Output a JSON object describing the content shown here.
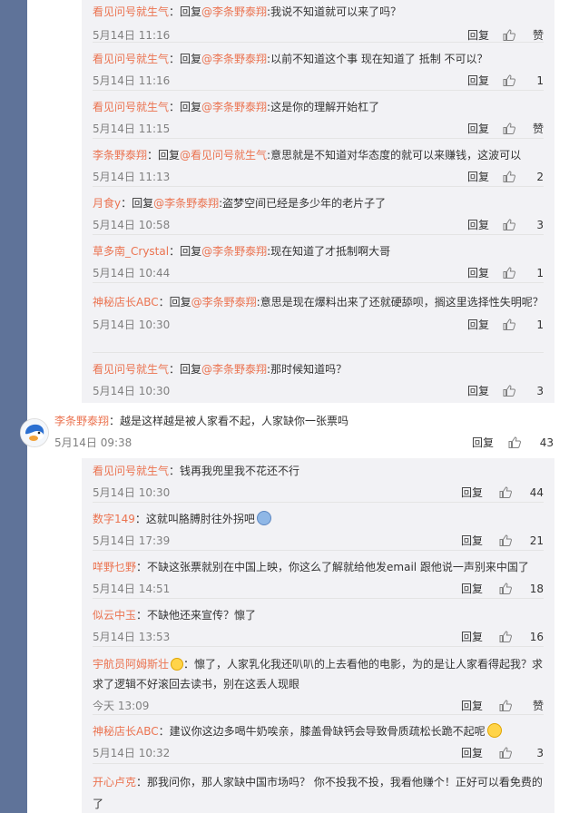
{
  "labels": {
    "reply": "回复"
  },
  "colors": {
    "username": "#eb7350",
    "background": "#5f7399",
    "reply_bg": "#f2f2f5"
  },
  "group1": [
    {
      "user": "看见问号就生气",
      "pre": "：回复",
      "mention": "@李条野泰翔",
      "text": ":我说不知道就可以来了吗？",
      "time": "5月14日 11:16",
      "likes": "赞"
    },
    {
      "user": "看见问号就生气",
      "pre": "：回复",
      "mention": "@李条野泰翔",
      "text": ":以前不知道这个事 现在知道了 抵制 不可以？",
      "time": "5月14日 11:16",
      "likes": "1"
    },
    {
      "user": "看见问号就生气",
      "pre": "：回复",
      "mention": "@李条野泰翔",
      "text": ":这是你的理解开始杠了",
      "time": "5月14日 11:15",
      "likes": "赞"
    },
    {
      "user": "李条野泰翔",
      "pre": "：回复",
      "mention": "@看见问号就生气",
      "text": ":意思就是不知道对华态度的就可以来赚钱，这波可以",
      "time": "5月14日 11:13",
      "likes": "2"
    },
    {
      "user": "月食y",
      "pre": "：回复",
      "mention": "@李条野泰翔",
      "text": ":盗梦空间已经是多少年的老片子了",
      "time": "5月14日 10:58",
      "likes": "3"
    },
    {
      "user": "草多南_Crystal",
      "pre": "：回复",
      "mention": "@李条野泰翔",
      "text": ":现在知道了才抵制啊大哥",
      "time": "5月14日 10:44",
      "likes": "1"
    },
    {
      "user": "神秘店长ABC",
      "pre": "：回复",
      "mention": "@李条野泰翔",
      "text": ":意思是现在爆料出来了还就硬舔呗，搁这里选择性失明呢？",
      "time": "5月14日 10:30",
      "likes": "1"
    },
    {
      "user": "看见问号就生气",
      "pre": "：回复",
      "mention": "@李条野泰翔",
      "text": ":那时候知道吗？",
      "time": "5月14日 10:30",
      "likes": "3"
    }
  ],
  "top_comment": {
    "user": "李条野泰翔",
    "text": "：越是这样越是被人家看不起，人家缺你一张票吗",
    "time": "5月14日 09:38",
    "likes": "43"
  },
  "group2": [
    {
      "user": "看见问号就生气",
      "text": "：钱再我兜里我不花还不行",
      "time": "5月14日 10:30",
      "likes": "44"
    },
    {
      "user": "数字149",
      "text": "：这就叫胳膊肘往外拐吧",
      "emoji": "doraemon",
      "time": "5月14日 17:39",
      "likes": "21"
    },
    {
      "user": "咩野乜野",
      "text": "：不缺这张票就别在中国上映，你这么了解就给他发email 跟他说一声别来中国了",
      "time": "5月14日 14:51",
      "likes": "18"
    },
    {
      "user": "似云中玉",
      "text": "：不缺他还来宣传？懔了",
      "time": "5月14日 13:53",
      "likes": "16"
    },
    {
      "user": "宇航员阿姆斯壮",
      "badge": "flower",
      "text": "：懔了，人家乳化我还叭叭的上去看他的电影，为的是让人家看得起我？求求了逻辑不好滚回去读书，别在这丢人现眼",
      "time": "今天 13:09",
      "likes": "赞"
    },
    {
      "user": "神秘店长ABC",
      "text": "：建议你这边多喝牛奶唉亲，膝盖骨缺钙会导致骨质疏松长跪不起呢",
      "emoji": "sweat-smile",
      "time": "5月14日 10:32",
      "likes": "3"
    },
    {
      "user": "开心卢克",
      "text": "：那我问你，那人家缺中国市场吗？ 你不投我不投，我看他赚个！正好可以看免费的了",
      "time": "",
      "likes": ""
    }
  ]
}
